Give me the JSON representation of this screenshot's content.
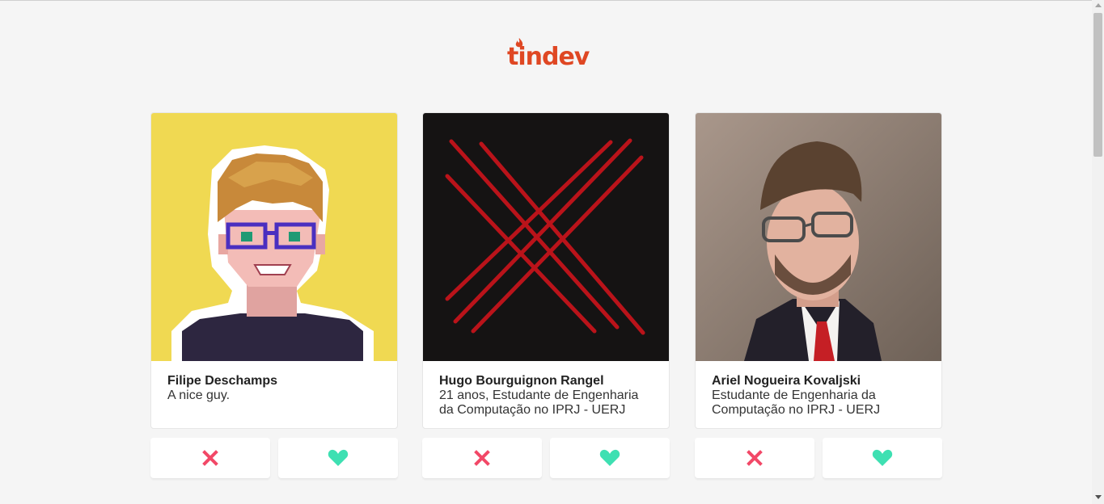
{
  "app": {
    "logo_text": "tindev",
    "brand_color": "#df4723"
  },
  "colors": {
    "dislike": "#f24867",
    "like": "#3ee0b2"
  },
  "devs": [
    {
      "name": "Filipe Deschamps",
      "bio": "A nice guy.",
      "avatar": "pixel-art-avatar"
    },
    {
      "name": "Hugo Bourguignon Rangel",
      "bio": "21 anos, Estudante de Engenharia da Computação no IPRJ - UERJ",
      "avatar": "red-claw-x-avatar"
    },
    {
      "name": "Ariel Nogueira Kovaljski",
      "bio": "Estudante de Engenharia da Computação no IPRJ - UERJ",
      "avatar": "portrait-photo"
    }
  ],
  "actions": {
    "dislike_icon": "close-icon",
    "like_icon": "heart-icon"
  }
}
